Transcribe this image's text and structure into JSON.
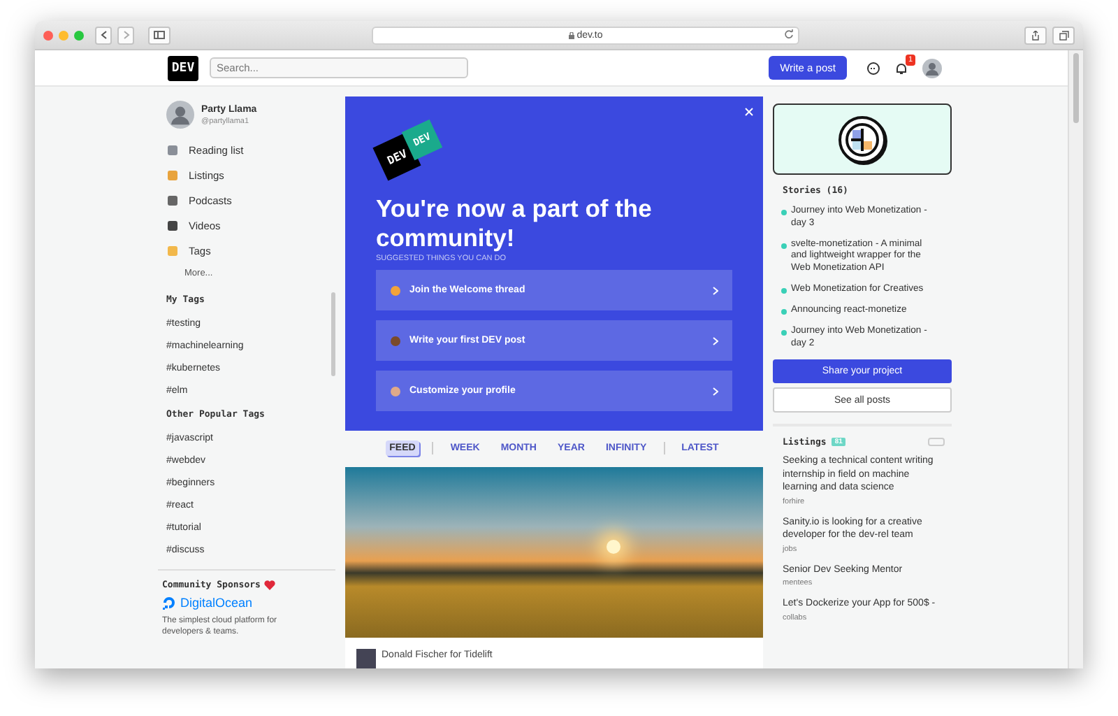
{
  "browser": {
    "url": "dev.to"
  },
  "header": {
    "logo": "DEV",
    "search_placeholder": "Search...",
    "write_button": "Write a post",
    "notification_count": "1"
  },
  "sidebar": {
    "user": {
      "name": "Party Llama",
      "handle": "@partyllama1"
    },
    "nav": [
      {
        "label": "Reading list"
      },
      {
        "label": "Listings"
      },
      {
        "label": "Podcasts"
      },
      {
        "label": "Videos"
      },
      {
        "label": "Tags"
      }
    ],
    "more": "More...",
    "my_tags": {
      "title": "My Tags",
      "tags": [
        "#testing",
        "#machinelearning",
        "#kubernetes",
        "#elm"
      ]
    },
    "popular_tags": {
      "title": "Other Popular Tags",
      "tags": [
        "#javascript",
        "#webdev",
        "#beginners",
        "#react",
        "#tutorial",
        "#discuss"
      ]
    },
    "sponsors": {
      "title": "Community Sponsors",
      "name": "DigitalOcean",
      "description": "The simplest cloud platform for developers & teams."
    }
  },
  "welcome": {
    "logo_back": "DEV",
    "logo_front": "DEV",
    "title": "You're now a part of the community!",
    "subtitle": "SUGGESTED THINGS YOU CAN DO",
    "actions": [
      {
        "label": "Join the Welcome thread"
      },
      {
        "label": "Write your first DEV post"
      },
      {
        "label": "Customize your profile"
      }
    ]
  },
  "feed_tabs": [
    {
      "label": "FEED",
      "selected": true
    },
    {
      "label": "WEEK",
      "selected": false
    },
    {
      "label": "MONTH",
      "selected": false
    },
    {
      "label": "YEAR",
      "selected": false
    },
    {
      "label": "INFINITY",
      "selected": false
    },
    {
      "label": "LATEST",
      "selected": false
    }
  ],
  "article": {
    "byline": "Donald Fischer for Tidelift"
  },
  "stories": {
    "title": "Stories (16)",
    "items": [
      "Journey into Web Monetization - day 3",
      "svelte-monetization - A minimal and lightweight wrapper for the Web Monetization API",
      "Web Monetization for Creatives",
      "Announcing react-monetize",
      "Journey into Web Monetization - day 2"
    ],
    "share_button": "Share your project",
    "see_all_button": "See all posts"
  },
  "listings": {
    "title": "Listings",
    "count": "81",
    "items": [
      {
        "title": "Seeking a technical content writing internship in field on machine learning and data science",
        "category": "forhire"
      },
      {
        "title": "Sanity.io is looking for a creative developer for the dev-rel team",
        "category": "jobs"
      },
      {
        "title": "Senior Dev Seeking Mentor",
        "category": "mentees"
      },
      {
        "title": "Let's Dockerize your App for 500$ -",
        "category": "collabs"
      }
    ]
  }
}
